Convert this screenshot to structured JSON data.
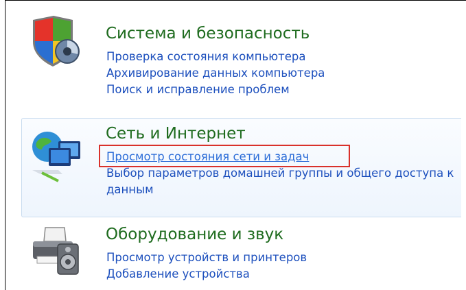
{
  "categories": [
    {
      "title": "Система и безопасность",
      "icon": "shield-icon",
      "links": [
        "Проверка состояния компьютера",
        "Архивирование данных компьютера",
        "Поиск и исправление проблем"
      ]
    },
    {
      "title": "Сеть и Интернет",
      "icon": "network-globe-icon",
      "links": [
        "Просмотр состояния сети и задач",
        "Выбор параметров домашней группы и общего доступа к данным"
      ]
    },
    {
      "title": "Оборудование и звук",
      "icon": "printer-speaker-icon",
      "links": [
        "Просмотр устройств и принтеров",
        "Добавление устройства"
      ]
    }
  ],
  "colors": {
    "title_green": "#1e6b1e",
    "link_blue": "#1c4fbd",
    "highlight_red": "#d9312b"
  }
}
